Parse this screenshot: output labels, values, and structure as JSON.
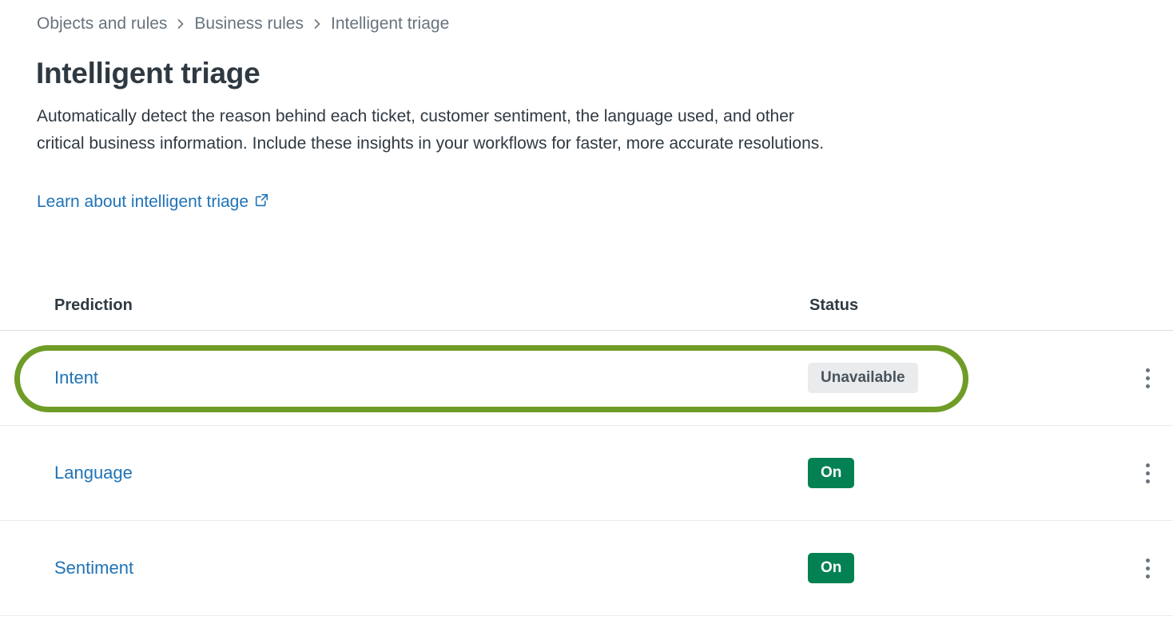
{
  "breadcrumb": {
    "separator_icon": "chevron-right-icon",
    "items": [
      {
        "label": "Objects and rules",
        "is_link": true
      },
      {
        "label": "Business rules",
        "is_link": true
      },
      {
        "label": "Intelligent triage",
        "is_link": false
      }
    ]
  },
  "page": {
    "title": "Intelligent triage",
    "description": "Automatically detect the reason behind each ticket, customer sentiment, the language used, and other critical business information. Include these insights in your workflows for faster, more accurate resolutions.",
    "learn_link_label": "Learn about intelligent triage",
    "learn_link_icon": "external-link-icon"
  },
  "table": {
    "columns": {
      "prediction": "Prediction",
      "status": "Status"
    },
    "row_menu_icon": "kebab-menu-icon",
    "rows": [
      {
        "prediction": "Intent",
        "status": "Unavailable",
        "status_kind": "neutral",
        "highlighted": true
      },
      {
        "prediction": "Language",
        "status": "On",
        "status_kind": "on",
        "highlighted": false
      },
      {
        "prediction": "Sentiment",
        "status": "On",
        "status_kind": "on",
        "highlighted": false
      }
    ]
  },
  "annotation": {
    "target": "Intent",
    "ring_color": "#6f9c27"
  },
  "colors": {
    "link": "#1f73b7",
    "text": "#2f3941",
    "muted": "#68737d",
    "badge_on_bg": "#038153",
    "badge_neutral_bg": "#e9ebed",
    "divider": "#e9ebed",
    "header_divider": "#d8dcde"
  }
}
